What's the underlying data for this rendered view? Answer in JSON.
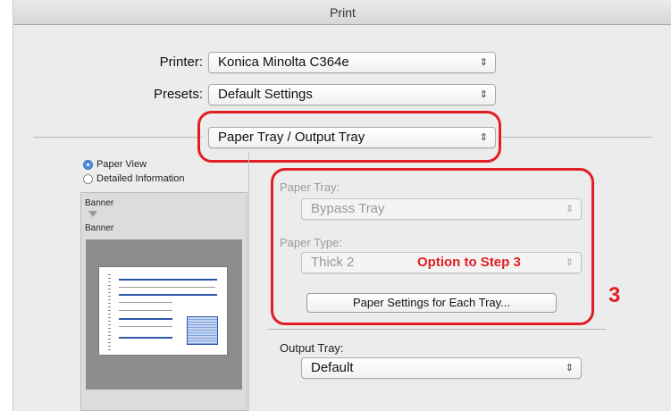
{
  "window": {
    "title": "Print"
  },
  "printer": {
    "label": "Printer:",
    "value": "Konica Minolta C364e"
  },
  "presets": {
    "label": "Presets:",
    "value": "Default Settings"
  },
  "panel_select": {
    "value": "Paper Tray / Output Tray"
  },
  "view_mode": {
    "options": [
      {
        "label": "Paper View",
        "selected": true
      },
      {
        "label": "Detailed Information",
        "selected": false
      }
    ]
  },
  "preview": {
    "top_label": "Banner",
    "bottom_label": "Banner"
  },
  "paper_tray": {
    "label": "Paper Tray:",
    "value": "Bypass Tray"
  },
  "paper_type": {
    "label": "Paper Type:",
    "value": "Thick 2"
  },
  "settings_button": {
    "label": "Paper Settings for Each Tray..."
  },
  "output_tray": {
    "label": "Output Tray:",
    "value": "Default"
  },
  "annotations": {
    "option_text": "Option to Step 3",
    "step_number": "3"
  },
  "colors": {
    "annotation_red": "#e01e25",
    "selection_blue": "#4f8de2"
  },
  "icons": {
    "popup_arrows": "up-down-chevron-icon",
    "disclosure": "triangle-down-icon"
  }
}
